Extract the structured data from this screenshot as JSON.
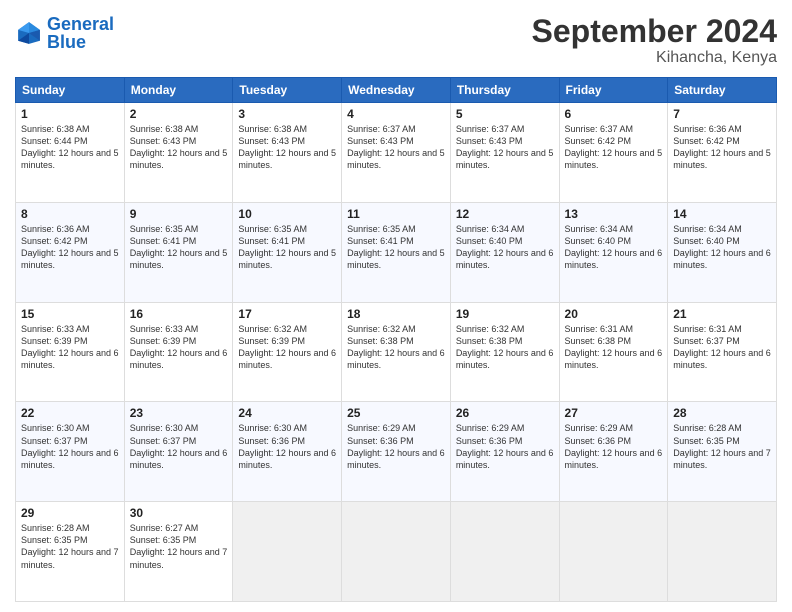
{
  "logo": {
    "text_general": "General",
    "text_blue": "Blue"
  },
  "header": {
    "month": "September 2024",
    "location": "Kihancha, Kenya"
  },
  "weekdays": [
    "Sunday",
    "Monday",
    "Tuesday",
    "Wednesday",
    "Thursday",
    "Friday",
    "Saturday"
  ],
  "weeks": [
    [
      {
        "day": "1",
        "sunrise": "6:38 AM",
        "sunset": "6:44 PM",
        "daylight": "12 hours and 5 minutes."
      },
      {
        "day": "2",
        "sunrise": "6:38 AM",
        "sunset": "6:43 PM",
        "daylight": "12 hours and 5 minutes."
      },
      {
        "day": "3",
        "sunrise": "6:38 AM",
        "sunset": "6:43 PM",
        "daylight": "12 hours and 5 minutes."
      },
      {
        "day": "4",
        "sunrise": "6:37 AM",
        "sunset": "6:43 PM",
        "daylight": "12 hours and 5 minutes."
      },
      {
        "day": "5",
        "sunrise": "6:37 AM",
        "sunset": "6:43 PM",
        "daylight": "12 hours and 5 minutes."
      },
      {
        "day": "6",
        "sunrise": "6:37 AM",
        "sunset": "6:42 PM",
        "daylight": "12 hours and 5 minutes."
      },
      {
        "day": "7",
        "sunrise": "6:36 AM",
        "sunset": "6:42 PM",
        "daylight": "12 hours and 5 minutes."
      }
    ],
    [
      {
        "day": "8",
        "sunrise": "6:36 AM",
        "sunset": "6:42 PM",
        "daylight": "12 hours and 5 minutes."
      },
      {
        "day": "9",
        "sunrise": "6:35 AM",
        "sunset": "6:41 PM",
        "daylight": "12 hours and 5 minutes."
      },
      {
        "day": "10",
        "sunrise": "6:35 AM",
        "sunset": "6:41 PM",
        "daylight": "12 hours and 5 minutes."
      },
      {
        "day": "11",
        "sunrise": "6:35 AM",
        "sunset": "6:41 PM",
        "daylight": "12 hours and 5 minutes."
      },
      {
        "day": "12",
        "sunrise": "6:34 AM",
        "sunset": "6:40 PM",
        "daylight": "12 hours and 6 minutes."
      },
      {
        "day": "13",
        "sunrise": "6:34 AM",
        "sunset": "6:40 PM",
        "daylight": "12 hours and 6 minutes."
      },
      {
        "day": "14",
        "sunrise": "6:34 AM",
        "sunset": "6:40 PM",
        "daylight": "12 hours and 6 minutes."
      }
    ],
    [
      {
        "day": "15",
        "sunrise": "6:33 AM",
        "sunset": "6:39 PM",
        "daylight": "12 hours and 6 minutes."
      },
      {
        "day": "16",
        "sunrise": "6:33 AM",
        "sunset": "6:39 PM",
        "daylight": "12 hours and 6 minutes."
      },
      {
        "day": "17",
        "sunrise": "6:32 AM",
        "sunset": "6:39 PM",
        "daylight": "12 hours and 6 minutes."
      },
      {
        "day": "18",
        "sunrise": "6:32 AM",
        "sunset": "6:38 PM",
        "daylight": "12 hours and 6 minutes."
      },
      {
        "day": "19",
        "sunrise": "6:32 AM",
        "sunset": "6:38 PM",
        "daylight": "12 hours and 6 minutes."
      },
      {
        "day": "20",
        "sunrise": "6:31 AM",
        "sunset": "6:38 PM",
        "daylight": "12 hours and 6 minutes."
      },
      {
        "day": "21",
        "sunrise": "6:31 AM",
        "sunset": "6:37 PM",
        "daylight": "12 hours and 6 minutes."
      }
    ],
    [
      {
        "day": "22",
        "sunrise": "6:30 AM",
        "sunset": "6:37 PM",
        "daylight": "12 hours and 6 minutes."
      },
      {
        "day": "23",
        "sunrise": "6:30 AM",
        "sunset": "6:37 PM",
        "daylight": "12 hours and 6 minutes."
      },
      {
        "day": "24",
        "sunrise": "6:30 AM",
        "sunset": "6:36 PM",
        "daylight": "12 hours and 6 minutes."
      },
      {
        "day": "25",
        "sunrise": "6:29 AM",
        "sunset": "6:36 PM",
        "daylight": "12 hours and 6 minutes."
      },
      {
        "day": "26",
        "sunrise": "6:29 AM",
        "sunset": "6:36 PM",
        "daylight": "12 hours and 6 minutes."
      },
      {
        "day": "27",
        "sunrise": "6:29 AM",
        "sunset": "6:36 PM",
        "daylight": "12 hours and 6 minutes."
      },
      {
        "day": "28",
        "sunrise": "6:28 AM",
        "sunset": "6:35 PM",
        "daylight": "12 hours and 7 minutes."
      }
    ],
    [
      {
        "day": "29",
        "sunrise": "6:28 AM",
        "sunset": "6:35 PM",
        "daylight": "12 hours and 7 minutes."
      },
      {
        "day": "30",
        "sunrise": "6:27 AM",
        "sunset": "6:35 PM",
        "daylight": "12 hours and 7 minutes."
      },
      null,
      null,
      null,
      null,
      null
    ]
  ]
}
